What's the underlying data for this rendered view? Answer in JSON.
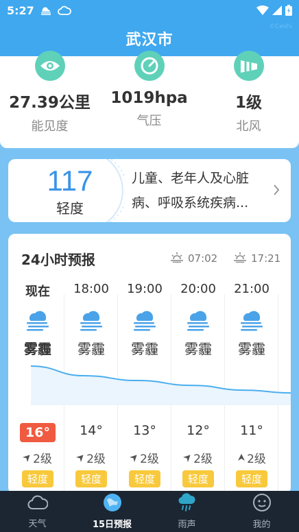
{
  "status_bar": {
    "time": "5:27"
  },
  "header": {
    "city": "武汉市",
    "watermark": "©Ceshi"
  },
  "indicators": [
    {
      "value": "27.39公里",
      "label": "能见度",
      "icon": "eye-icon"
    },
    {
      "value": "1019hpa",
      "label": "气压",
      "icon": "gauge-icon"
    },
    {
      "value": "1级",
      "label": "北风",
      "icon": "windsock-icon"
    }
  ],
  "aqi": {
    "value": "117",
    "level": "轻度",
    "desc_line1": "儿童、老年人及心脏",
    "desc_line2": "病、呼吸系统疾病..."
  },
  "forecast": {
    "title": "24小时预报",
    "sunrise": "07:02",
    "sunset": "17:21",
    "hours": [
      {
        "time": "现在",
        "weather": "雾霾",
        "temp": "16°",
        "wind": "2级",
        "wind_dir": "southwest",
        "aqi": "轻度",
        "temp_value": 16
      },
      {
        "time": "18:00",
        "weather": "雾霾",
        "temp": "14°",
        "wind": "2级",
        "wind_dir": "southwest",
        "aqi": "轻度",
        "temp_value": 14
      },
      {
        "time": "19:00",
        "weather": "雾霾",
        "temp": "13°",
        "wind": "2级",
        "wind_dir": "southwest",
        "aqi": "轻度",
        "temp_value": 13
      },
      {
        "time": "20:00",
        "weather": "雾霾",
        "temp": "12°",
        "wind": "2级",
        "wind_dir": "southwest",
        "aqi": "轻度",
        "temp_value": 12
      },
      {
        "time": "21:00",
        "weather": "雾霾",
        "temp": "11°",
        "wind": "2级",
        "wind_dir": "south",
        "aqi": "轻度",
        "temp_value": 11
      }
    ]
  },
  "nav": [
    {
      "label": "天气",
      "icon": "cloud-icon",
      "active": false
    },
    {
      "label": "15日预报",
      "icon": "globe-icon",
      "active": true
    },
    {
      "label": "雨声",
      "icon": "rain-cloud-icon",
      "active": false
    },
    {
      "label": "我的",
      "icon": "smiley-icon",
      "active": false
    }
  ],
  "colors": {
    "primary": "#3fa8ef",
    "aqi_blue": "#3a94e8",
    "indicator_green": "#5fd1b9",
    "now_temp_bg": "#ef5a40",
    "aqi_badge": "#f8c93c",
    "nav_bg": "#1c2633"
  }
}
